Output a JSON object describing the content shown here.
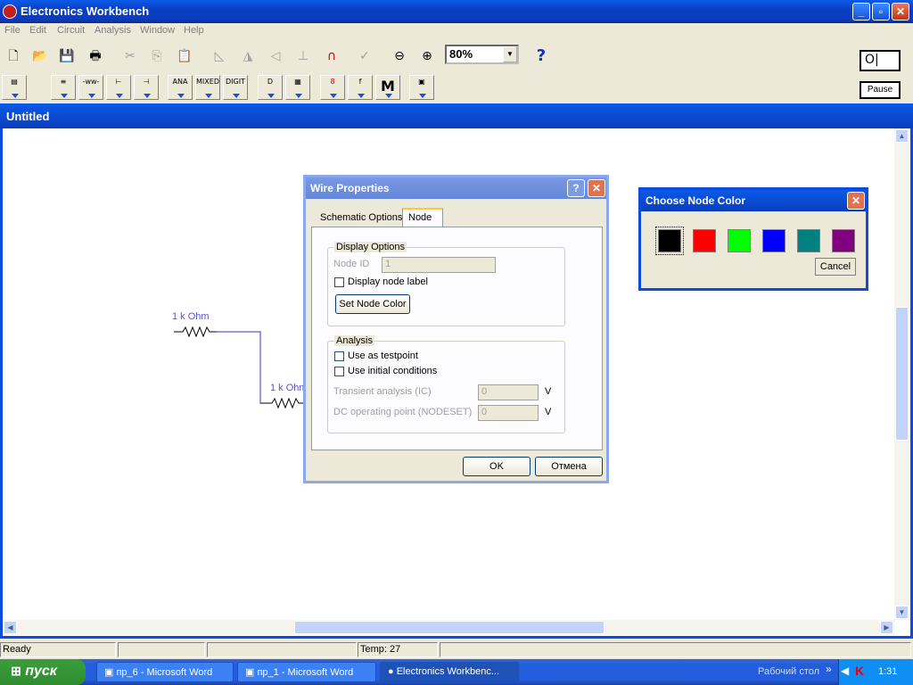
{
  "app": {
    "title": "Electronics Workbench"
  },
  "menu": [
    "File",
    "Edit",
    "Circuit",
    "Analysis",
    "Window",
    "Help"
  ],
  "toolbar": {
    "zoom": "80%",
    "help": "?",
    "parts": {
      "ana": "ANA",
      "mixed": "MIXED",
      "digit": "DIGIT",
      "m": "M"
    }
  },
  "power": {
    "label": "O|"
  },
  "pause": {
    "label": "Pause"
  },
  "doc": {
    "title": "Untitled"
  },
  "circuit": {
    "r1": "1 k Ohm",
    "r2": "1 k Ohm"
  },
  "wire_dialog": {
    "title": "Wire Properties",
    "tabs": [
      "Schematic Options",
      "Node"
    ],
    "display_group": "Display Options",
    "node_id_label": "Node ID",
    "node_id_value": "1",
    "display_label": "Display node label",
    "set_color": "Set Node Color",
    "analysis_group": "Analysis",
    "testpoint": "Use as testpoint",
    "initial": "Use initial conditions",
    "transient_label": "Transient analysis (IC)",
    "transient_value": "0",
    "transient_unit": "V",
    "dcop_label": "DC operating point (NODESET)",
    "dcop_value": "0",
    "dcop_unit": "V",
    "ok": "OK",
    "cancel": "Отмена"
  },
  "color_dialog": {
    "title": "Choose Node Color",
    "colors": [
      "#000000",
      "#ff0000",
      "#00ff00",
      "#0000ff",
      "#008080",
      "#800080"
    ],
    "cancel": "Cancel"
  },
  "status": {
    "ready": "Ready",
    "temp": "Temp:  27"
  },
  "taskbar": {
    "start": "пуск",
    "tasks": [
      "пр_6 - Microsoft Word",
      "пр_1 - Microsoft Word",
      "Electronics Workbenc..."
    ],
    "desktop": "Рабочий стол",
    "clock": "1:31"
  }
}
